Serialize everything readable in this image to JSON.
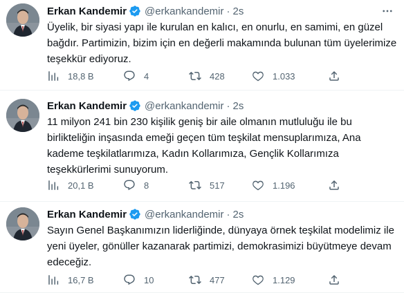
{
  "tweets": [
    {
      "name": "Erkan Kandemir",
      "handle": "@erkankandemir",
      "separator": "·",
      "time": "2s",
      "text": "Üyelik, bir siyasi yapı ile kurulan en kalıcı, en onurlu, en samimi, en güzel\nbağdır. Partimizin, bizim için en değerli makamında bulunan tüm üyelerimize\nteşekkür ediyoruz.",
      "views": "18,8 B",
      "replies": "4",
      "retweets": "428",
      "likes": "1.033"
    },
    {
      "name": "Erkan Kandemir",
      "handle": "@erkankandemir",
      "separator": "·",
      "time": "2s",
      "text": "11 milyon 241 bin 230 kişilik geniş bir aile olmanın mutluluğu ile bu\nbirlikteliğin inşasında emeği geçen tüm teşkilat mensuplarımıza, Ana\nkademe teşkilatlarımıza, Kadın Kollarımıza, Gençlik Kollarımıza\nteşekkürlerimi sunuyorum.",
      "views": "20,1 B",
      "replies": "8",
      "retweets": "517",
      "likes": "1.196"
    },
    {
      "name": "Erkan Kandemir",
      "handle": "@erkankandemir",
      "separator": "·",
      "time": "2s",
      "text": "Sayın Genel Başkanımızın liderliğinde, dünyaya örnek teşkilat modelimiz ile\nyeni üyeler, gönüller kazanarak partimizi, demokrasimizi büyütmeye devam\nedeceğiz.",
      "views": "16,7 B",
      "replies": "10",
      "retweets": "477",
      "likes": "1.129"
    }
  ],
  "colors": {
    "verified_badge": "#1d9bf0",
    "secondary_text": "#536471",
    "primary_text": "#0f1419",
    "divider": "#eff3f4"
  },
  "icons": [
    "analytics-icon",
    "reply-icon",
    "retweet-icon",
    "like-icon",
    "share-icon",
    "more-icon",
    "verified-icon"
  ]
}
